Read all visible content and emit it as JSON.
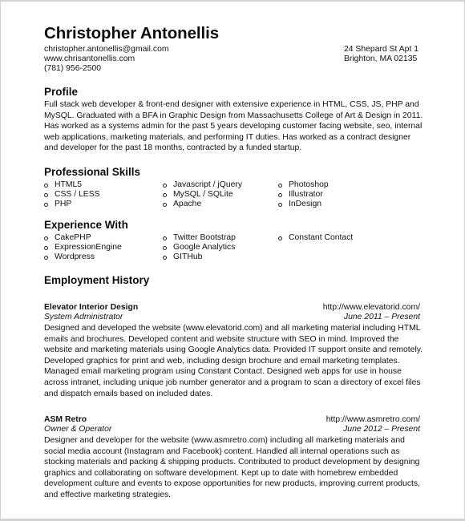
{
  "header": {
    "name": "Christopher Antonellis",
    "email": "christopher.antonellis@gmail.com",
    "website": "www.chrisantonellis.com",
    "phone": "(781) 956-2500",
    "address_line1": "24 Shepard St Apt 1",
    "address_line2": "Brighton, MA 02135"
  },
  "profile": {
    "heading": "Profile",
    "text": "Full stack web developer & front-end designer with extensive experience in HTML, CSS, JS, PHP and MySQL. Graduated with a BFA in Graphic Design from Massachusetts College of Art & Design in 2011. Has worked as a systems admin for the past 5 years developing customer facing website, seo, internal web applications, marketing materials, and performing IT duties. Has worked as a contract designer and developer for the past 18 months, contracted by a funded startup."
  },
  "skills": {
    "heading": "Professional Skills",
    "columns": [
      [
        "HTML5",
        "CSS / LESS",
        "PHP"
      ],
      [
        "Javascript / jQuery",
        "MySQL / SQLite",
        "Apache"
      ],
      [
        "Photoshop",
        "Illustrator",
        "InDesign"
      ]
    ]
  },
  "experience": {
    "heading": "Experience With",
    "columns": [
      [
        "CakePHP",
        "ExpressionEngine",
        "Wordpress"
      ],
      [
        "Twitter Bootstrap",
        "Google Analytics",
        "GITHub"
      ],
      [
        "Constant Contact"
      ]
    ]
  },
  "employment": {
    "heading": "Employment History",
    "jobs": [
      {
        "company": "Elevator Interior Design",
        "url": "http://www.elevatorid.com/",
        "role": "System Administrator",
        "dates": "June 2011 – Present",
        "description": "Designed and developed the website (www.elevatorid.com) and all marketing material including HTML emails and brochures. Developed content and website structure with SEO in mind. Improved the website and marketing materials using Google Analytics data. Provided IT support onsite and remotely. Developed graphics for print and web, including design brochure and email marketing templates. Managed email marketing program using Constant Contact. Designed web apps for use in house across intranet, including unique job number generator and a program to scan a directory of excel files and dispatch emails based on included dates."
      },
      {
        "company": "ASM Retro",
        "url": "http://www.asmretro.com/",
        "role": "Owner & Operator",
        "dates": "June 2012 – Present",
        "description": "Designer and developer for the website (www.asmretro.com) including all marketing materials and social media account (Instagram and Facebook) content. Handled all internal operations such as stocking materials and packing & shipping products. Contributed to product development by designing graphics and collaborating on software development. Kept up to date with homebrew embedded development culture and events to expose opportunities for new products, improving current products, and effective marketing strategies."
      }
    ]
  }
}
